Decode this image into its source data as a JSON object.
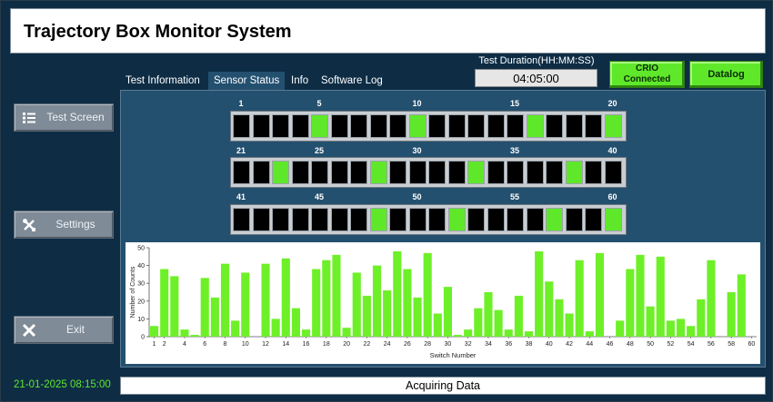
{
  "app": {
    "title": "Trajectory Box Monitor System"
  },
  "test_duration": {
    "label": "Test Duration(HH:MM:SS)",
    "value": "04:05:00"
  },
  "crio_button": {
    "line1": "CRIO",
    "line2": "Connected",
    "color": "#5fe82a"
  },
  "datalog_button": {
    "label": "Datalog",
    "color": "#5fe82a"
  },
  "sidebar": {
    "test_screen": {
      "label": "Test Screen",
      "icon": "list-icon"
    },
    "settings": {
      "label": "Settings",
      "icon": "wrench-screwdriver-icon"
    },
    "exit": {
      "label": "Exit",
      "icon": "close-icon"
    }
  },
  "tabs": [
    {
      "label": "Test Information",
      "active": false
    },
    {
      "label": "Sensor Status",
      "active": true
    },
    {
      "label": "Info",
      "active": false
    },
    {
      "label": "Software Log",
      "active": false
    }
  ],
  "switch_rows": [
    {
      "labels": [
        "1",
        "5",
        "10",
        "15",
        "20"
      ],
      "active": [
        5,
        10,
        16,
        20
      ]
    },
    {
      "labels": [
        "21",
        "25",
        "30",
        "35",
        "40"
      ],
      "active": [
        23,
        28,
        33,
        38
      ]
    },
    {
      "labels": [
        "41",
        "45",
        "50",
        "55",
        "60"
      ],
      "active": [
        48,
        52,
        57,
        60
      ]
    }
  ],
  "colors": {
    "on": "#5fe82a",
    "off": "#000000",
    "bar": "#6ef028"
  },
  "chart_data": {
    "type": "bar",
    "x": [
      1,
      2,
      3,
      4,
      5,
      6,
      7,
      8,
      9,
      10,
      11,
      12,
      13,
      14,
      15,
      16,
      17,
      18,
      19,
      20,
      21,
      22,
      23,
      24,
      25,
      26,
      27,
      28,
      29,
      30,
      31,
      32,
      33,
      34,
      35,
      36,
      37,
      38,
      39,
      40,
      41,
      42,
      43,
      44,
      45,
      46,
      47,
      48,
      49,
      50,
      51,
      52,
      53,
      54,
      55,
      56,
      57,
      58,
      59,
      60
    ],
    "values": [
      6,
      38,
      34,
      4,
      1,
      33,
      22,
      41,
      9,
      36,
      0,
      41,
      10,
      44,
      16,
      4,
      38,
      43,
      46,
      5,
      36,
      23,
      40,
      26,
      48,
      38,
      22,
      47,
      13,
      28,
      1,
      4,
      16,
      25,
      15,
      4,
      23,
      3,
      48,
      31,
      21,
      13,
      43,
      3,
      47,
      0,
      9,
      38,
      46,
      17,
      45,
      9,
      10,
      6,
      21,
      43,
      0,
      25,
      35,
      0
    ],
    "xlabel": "Switch Number",
    "ylabel": "Number of Counts",
    "ylim": [
      0,
      50
    ],
    "yticks": [
      0,
      10,
      20,
      30,
      40,
      50
    ],
    "xticks": [
      "1",
      "2",
      "4",
      "6",
      "8",
      "10",
      "12",
      "14",
      "16",
      "18",
      "20",
      "22",
      "24",
      "26",
      "28",
      "30",
      "32",
      "34",
      "36",
      "38",
      "40",
      "42",
      "44",
      "46",
      "48",
      "50",
      "52",
      "54",
      "56",
      "58",
      "60"
    ]
  },
  "status": {
    "text": "Acquiring Data"
  },
  "datetime": "21-01-2025 08:15:00"
}
